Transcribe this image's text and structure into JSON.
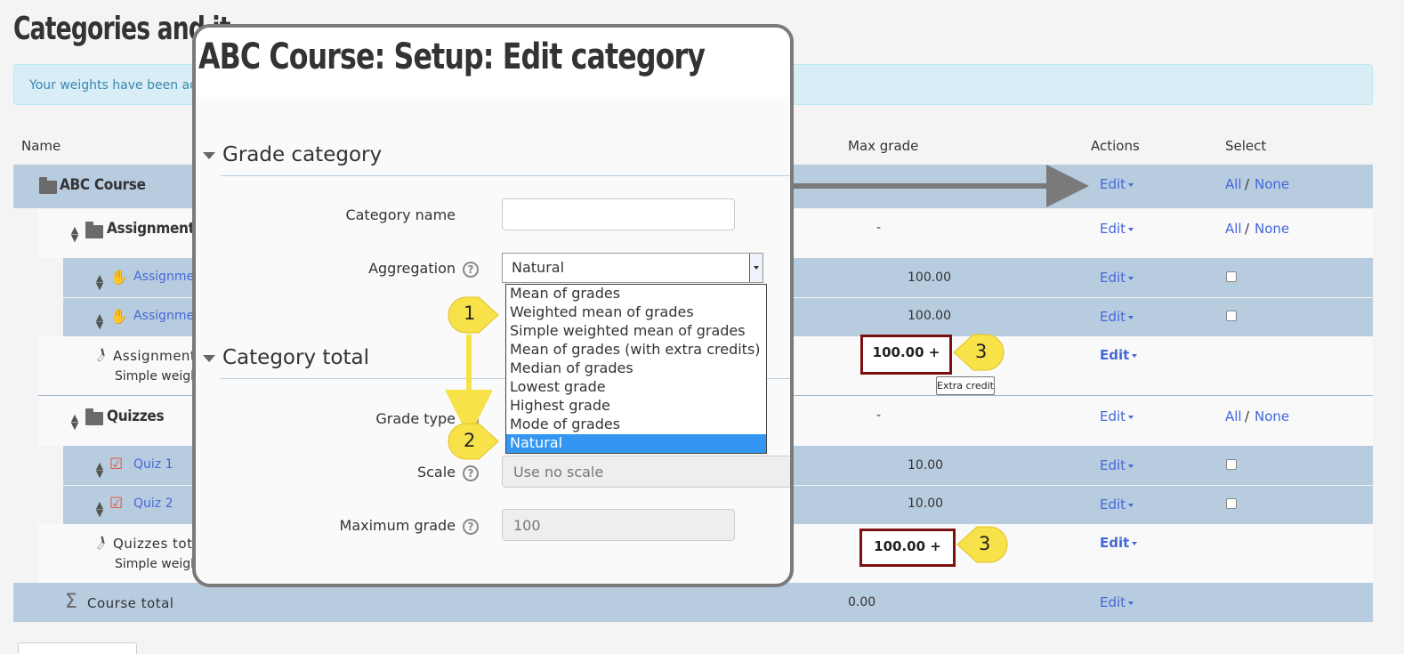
{
  "page": {
    "title": "Categories and it",
    "alert": "Your weights have been adj"
  },
  "table": {
    "headers": {
      "name": "Name",
      "max_grade": "Max grade",
      "actions": "Actions",
      "select": "Select"
    },
    "all_label": "All",
    "none_label": "None",
    "slash": "/",
    "edit_label": "Edit",
    "rows": {
      "course": {
        "name": "ABC Course"
      },
      "assignments": {
        "name": "Assignments",
        "max": "-"
      },
      "assignment1": {
        "name": "Assignme",
        "max": "100.00"
      },
      "assignment2": {
        "name": "Assignme",
        "max": "100.00"
      },
      "assignments_total": {
        "name": "Assignment",
        "sub": "Simple weigh",
        "max": "100.00 +"
      },
      "quizzes": {
        "name": "Quizzes",
        "max": "-"
      },
      "quiz1": {
        "name": "Quiz 1",
        "max": "10.00"
      },
      "quiz2": {
        "name": "Quiz 2",
        "max": "10.00"
      },
      "quizzes_total": {
        "name": "Quizzes total",
        "sub": "Simple weighted mean of grades.",
        "max": "100.00 +"
      },
      "course_total": {
        "name": "Course total",
        "max": "0.00"
      }
    },
    "tooltip": "Extra credit"
  },
  "callouts": {
    "one": "1",
    "two": "2",
    "three": "3"
  },
  "modal": {
    "title": "ABC Course: Setup: Edit category",
    "section1": "Grade category",
    "section2": "Category total",
    "category_name_label": "Category name",
    "category_name_value": "",
    "aggregation_label": "Aggregation",
    "aggregation_value": "Natural",
    "aggregation_options": [
      "Mean of grades",
      "Weighted mean of grades",
      "Simple weighted mean of grades",
      "Mean of grades (with extra credits)",
      "Median of grades",
      "Lowest grade",
      "Highest grade",
      "Mode of grades",
      "Natural"
    ],
    "grade_type_label": "Grade type",
    "scale_label": "Scale",
    "scale_value": "Use no scale",
    "max_grade_label": "Maximum grade",
    "max_grade_value": "100",
    "help_glyph": "?"
  },
  "colors": {
    "row_blue": "#b8cce0",
    "link": "#4467d8",
    "callout": "#f7e24a",
    "highlight_border": "#7a1010",
    "selected_option": "#3296f2"
  }
}
